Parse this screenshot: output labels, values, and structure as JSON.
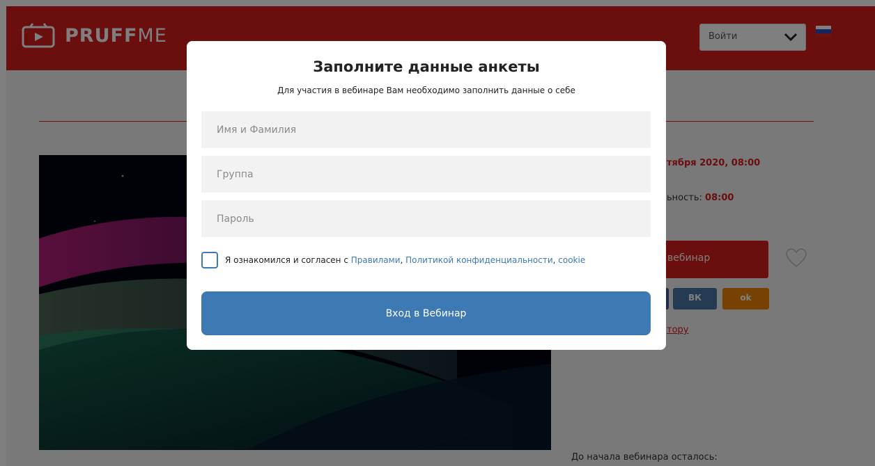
{
  "header": {
    "logo_bold": "PRUFF",
    "logo_light": "ME",
    "login_select": "Войти",
    "flag_colors": [
      "#ffffff",
      "#2a4fc4",
      "#d52b1e"
    ]
  },
  "webinar": {
    "date_partial": "тября 2020, 08:00",
    "duration_partial_label": "ьность:",
    "duration_value": "08:00",
    "register_partial": "вебинар",
    "vk_label": "ВК",
    "ok_label": "ok",
    "author_partial": "тору",
    "countdown_label": "До начала вебинара осталось:"
  },
  "modal": {
    "title": "Заполните данные анкеты",
    "subtitle": "Для участия в вебинаре Вам необходимо заполнить данные о себе",
    "fields": [
      {
        "placeholder": "Имя и Фамилия",
        "value": ""
      },
      {
        "placeholder": "Группа",
        "value": ""
      },
      {
        "placeholder": "Пароль",
        "value": ""
      }
    ],
    "agree": {
      "text": "Я ознакомился и согласен с ",
      "rules_link": "Правилами",
      "sep1": ", ",
      "privacy_link": "Политикой конфиденциальности",
      "sep2": ", ",
      "cookie_link": "cookie",
      "checked": false
    },
    "submit_label": "Вход в Вебинар"
  },
  "colors": {
    "brand_red": "#d61d1d",
    "accent_blue": "#3d79b3"
  }
}
